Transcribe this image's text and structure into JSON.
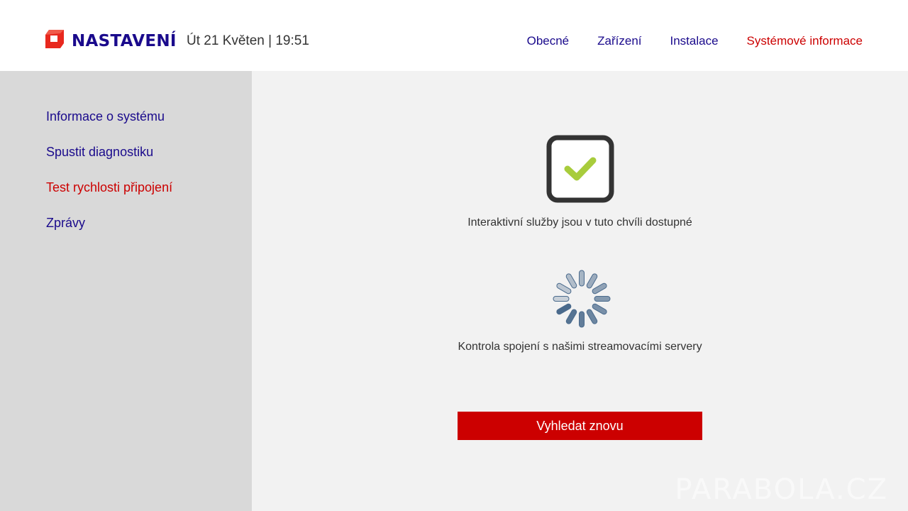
{
  "header": {
    "brand": "NASTAVENÍ",
    "datetime": "Út 21 Květen | 19:51",
    "nav": [
      {
        "label": "Obecné"
      },
      {
        "label": "Zařízení"
      },
      {
        "label": "Instalace"
      },
      {
        "label": "Systémové informace"
      }
    ],
    "active_nav": "Systémové informace",
    "logo_icon": "logo-icon"
  },
  "sidebar": {
    "items": [
      {
        "label": "Informace o systému"
      },
      {
        "label": "Spustit diagnostiku"
      },
      {
        "label": "Test rychlosti připojení"
      },
      {
        "label": "Zprávy"
      }
    ],
    "active_item": "Test rychlosti připojení"
  },
  "main": {
    "check_icon": "checkmark-icon",
    "interactive_status": "Interaktivní služby jsou v tuto chvíli dostupné",
    "spinner_icon": "loading-spinner-icon",
    "streaming_status": "Kontrola spojení s našimi streamovacími servery",
    "retry_label": "Vyhledat znovu"
  },
  "watermark": "PARABOLA.CZ",
  "colors": {
    "accent_red": "#cc0000",
    "nav_blue": "#1a0a8c",
    "check_green": "#a8cc3c",
    "spinner_blue": "#4a6a8c",
    "sidebar_bg": "#d9d9d9",
    "main_bg": "#f2f2f2"
  }
}
